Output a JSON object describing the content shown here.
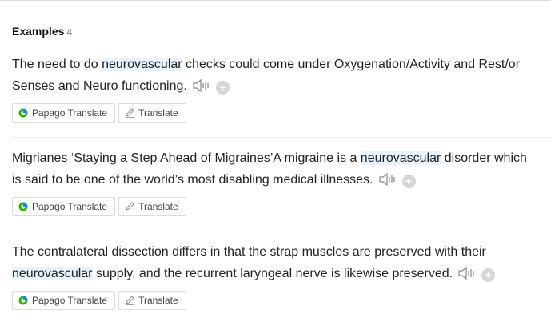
{
  "section": {
    "title": "Examples",
    "count": "4"
  },
  "examples": [
    {
      "before": "The need to do ",
      "highlight": "neurovascular",
      "after": " checks could come under Oxygenation/Activity and Rest/or Senses and Neuro functioning.",
      "papago_label": "Papago Translate",
      "translate_label": "Translate"
    },
    {
      "before": "Migrianes ‘Staying a Step Ahead of Migraines’A migraine is a ",
      "highlight": "neurovascular",
      "after": " disorder which is said to be one of the world’s most disabling medical illnesses.",
      "papago_label": "Papago Translate",
      "translate_label": "Translate"
    },
    {
      "before": "The contralateral dissection differs in that the strap muscles are preserved with their ",
      "highlight": "neurovascular",
      "after": " supply, and the recurrent laryngeal nerve is likewise preserved.",
      "papago_label": "Papago Translate",
      "translate_label": "Translate"
    }
  ],
  "icons": {
    "speaker": "speaker-icon",
    "add": "plus-icon",
    "papago": "papago-icon",
    "translate": "pencil-icon"
  },
  "colors": {
    "highlight": "#e8f3fb",
    "papago_green": "#2db400",
    "papago_blue": "#1e88e5"
  }
}
